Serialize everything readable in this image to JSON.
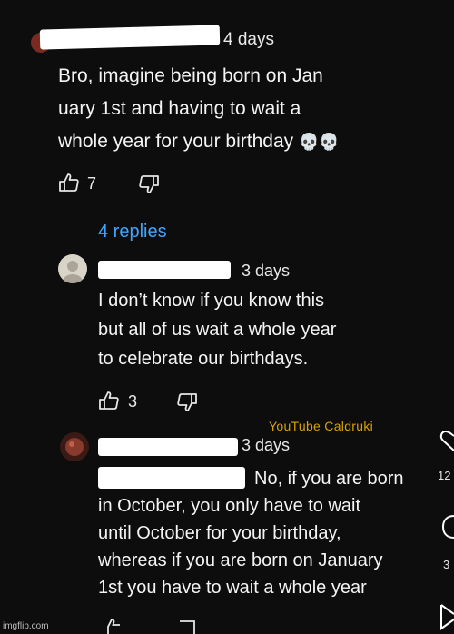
{
  "comment1": {
    "time": "4 days",
    "text_lines": [
      "Bro, imagine being born on Jan",
      "uary 1st and having to wait a",
      "whole year for your birthday"
    ],
    "emoji": "💀💀",
    "likes": "7"
  },
  "replies_link": "4 replies",
  "reply1": {
    "time": "3 days",
    "text_lines": [
      "I don’t know if you know this",
      "but all of us wait a whole year",
      "to celebrate our birthdays."
    ],
    "likes": "3"
  },
  "watermark": "YouTube Caldruki",
  "reply2": {
    "time": "3 days",
    "text_lines": [
      "No, if you are born",
      "in October, you only have to wait",
      "until October for your birthday,",
      "whereas if you are born on January",
      "1st you have to wait a whole year"
    ]
  },
  "side_counts": [
    "12",
    "3"
  ],
  "imgflip": "imgflip.com",
  "icons": {
    "like": "thumbs-up-icon",
    "dislike": "thumbs-down-icon",
    "side_like": "heart-icon",
    "side_comment": "comment-icon",
    "side_share": "share-icon"
  },
  "colors": {
    "link": "#3ea6ff",
    "watermark": "#d8a200",
    "background": "#0d0d0d"
  }
}
